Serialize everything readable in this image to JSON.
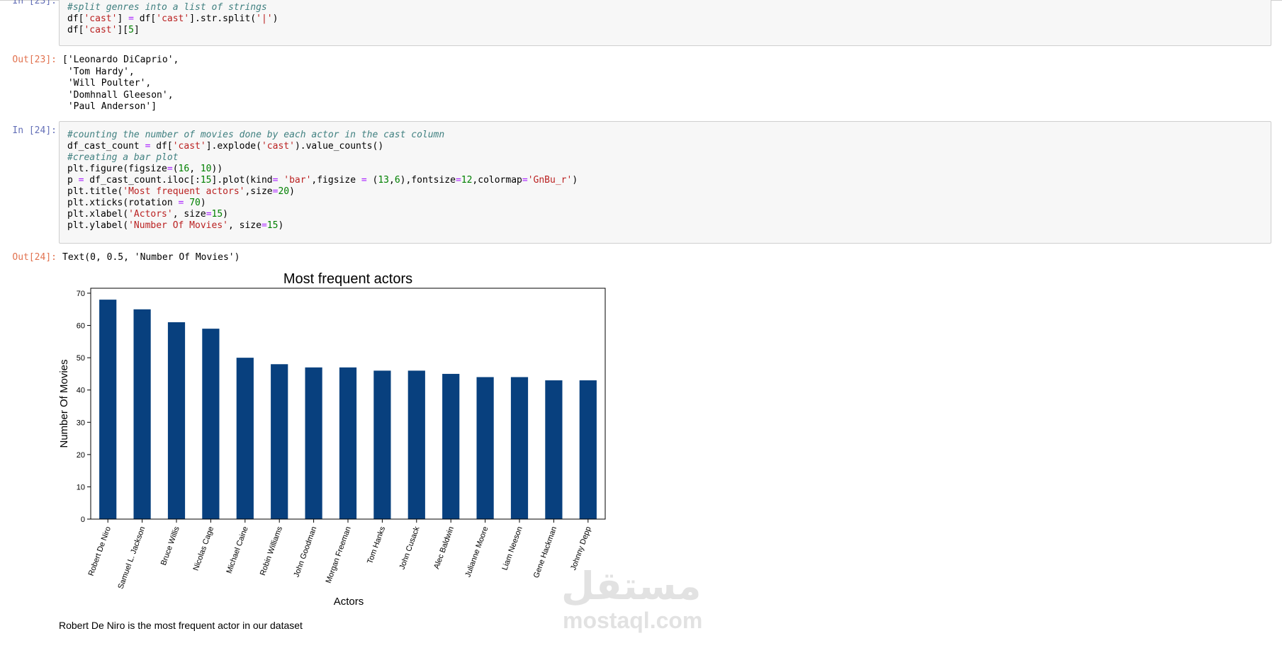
{
  "cells": {
    "c23": {
      "in_prompt": "In [23]:",
      "out_prompt": "Out[23]:",
      "code": [
        [
          [
            "cm",
            "#split genres into a list of strings"
          ]
        ],
        [
          [
            "",
            "df["
          ],
          [
            "st",
            "'cast'"
          ],
          [
            "",
            "] "
          ],
          [
            "op",
            "="
          ],
          [
            "",
            " df["
          ],
          [
            "st",
            "'cast'"
          ],
          [
            "",
            "].str.split("
          ],
          [
            "st",
            "'|'"
          ],
          [
            "",
            ")"
          ]
        ],
        [
          [
            "",
            "df["
          ],
          [
            "st",
            "'cast'"
          ],
          [
            "",
            "]["
          ],
          [
            "nu",
            "5"
          ],
          [
            "",
            "]"
          ]
        ]
      ],
      "output": [
        "['Leonardo DiCaprio',",
        " 'Tom Hardy',",
        " 'Will Poulter',",
        " 'Domhnall Gleeson',",
        " 'Paul Anderson']"
      ]
    },
    "c24": {
      "in_prompt": "In [24]:",
      "out_prompt": "Out[24]:",
      "code": [
        [
          [
            "cm",
            "#counting the number of movies done by each actor in the cast column"
          ]
        ],
        [
          [
            "",
            "df_cast_count "
          ],
          [
            "op",
            "="
          ],
          [
            "",
            " df["
          ],
          [
            "st",
            "'cast'"
          ],
          [
            "",
            "].explode("
          ],
          [
            "st",
            "'cast'"
          ],
          [
            "",
            ").value_counts()"
          ]
        ],
        [
          [
            "cm",
            "#creating a bar plot"
          ]
        ],
        [
          [
            "",
            "plt.figure(figsize"
          ],
          [
            "op",
            "="
          ],
          [
            "",
            "("
          ],
          [
            "nu",
            "16"
          ],
          [
            "",
            ", "
          ],
          [
            "nu",
            "10"
          ],
          [
            "",
            "))"
          ]
        ],
        [
          [
            "",
            "p "
          ],
          [
            "op",
            "="
          ],
          [
            "",
            " df_cast_count.iloc[:"
          ],
          [
            "nu",
            "15"
          ],
          [
            "",
            "].plot(kind"
          ],
          [
            "op",
            "="
          ],
          [
            "",
            " "
          ],
          [
            "st",
            "'bar'"
          ],
          [
            "",
            ",figsize "
          ],
          [
            "op",
            "="
          ],
          [
            "",
            " ("
          ],
          [
            "nu",
            "13"
          ],
          [
            "",
            ","
          ],
          [
            "nu",
            "6"
          ],
          [
            "",
            "),fontsize"
          ],
          [
            "op",
            "="
          ],
          [
            "nu",
            "12"
          ],
          [
            "",
            ",colormap"
          ],
          [
            "op",
            "="
          ],
          [
            "st",
            "'GnBu_r'"
          ],
          [
            "",
            ")"
          ]
        ],
        [
          [
            "",
            "plt.title("
          ],
          [
            "st",
            "'Most frequent actors'"
          ],
          [
            "",
            ",size"
          ],
          [
            "op",
            "="
          ],
          [
            "nu",
            "20"
          ],
          [
            "",
            ")"
          ]
        ],
        [
          [
            "",
            "plt.xticks(rotation "
          ],
          [
            "op",
            "="
          ],
          [
            "",
            " "
          ],
          [
            "nu",
            "70"
          ],
          [
            "",
            ")"
          ]
        ],
        [
          [
            "",
            "plt.xlabel("
          ],
          [
            "st",
            "'Actors'"
          ],
          [
            "",
            ", size"
          ],
          [
            "op",
            "="
          ],
          [
            "nu",
            "15"
          ],
          [
            "",
            ")"
          ]
        ],
        [
          [
            "",
            "plt.ylabel("
          ],
          [
            "st",
            "'Number Of Movies'"
          ],
          [
            "",
            ", size"
          ],
          [
            "op",
            "="
          ],
          [
            "nu",
            "15"
          ],
          [
            "",
            ")"
          ]
        ]
      ],
      "output": [
        "Text(0, 0.5, 'Number Of Movies')"
      ]
    }
  },
  "chart_data": {
    "type": "bar",
    "title": "Most frequent actors",
    "xlabel": "Actors",
    "ylabel": "Number Of Movies",
    "categories": [
      "Robert De Niro",
      "Samuel L. Jackson",
      "Bruce Willis",
      "Nicolas Cage",
      "Michael Caine",
      "Robin Williams",
      "John Goodman",
      "Morgan Freeman",
      "Tom Hanks",
      "John Cusack",
      "Alec Baldwin",
      "Julianne Moore",
      "Liam Neeson",
      "Gene Hackman",
      "Johnny Depp"
    ],
    "values": [
      68,
      65,
      61,
      59,
      50,
      48,
      47,
      47,
      46,
      46,
      45,
      44,
      44,
      43,
      43
    ],
    "ylim": [
      0,
      70
    ],
    "yticks": [
      0,
      10,
      20,
      30,
      40,
      50,
      60,
      70
    ],
    "bar_color": "#08407e",
    "grid": false
  },
  "markdown": {
    "text": "Robert De Niro is the most frequent actor in our dataset"
  },
  "watermark": {
    "arabic": "مستقل",
    "latin": "mostaql.com"
  }
}
